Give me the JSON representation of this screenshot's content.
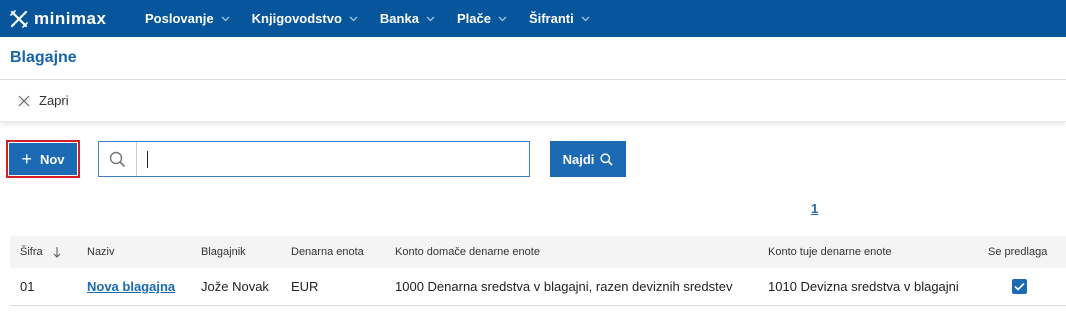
{
  "brand": {
    "name": "minimax"
  },
  "nav": {
    "items": [
      {
        "label": "Poslovanje"
      },
      {
        "label": "Knjigovodstvo"
      },
      {
        "label": "Banka"
      },
      {
        "label": "Plače"
      },
      {
        "label": "Šifranti"
      }
    ]
  },
  "page": {
    "title": "Blagajne"
  },
  "toolbar": {
    "close_label": "Zapri"
  },
  "actions": {
    "new_label": "Nov",
    "find_label": "Najdi"
  },
  "search": {
    "value": "",
    "placeholder": ""
  },
  "pagination": {
    "current": "1"
  },
  "table": {
    "headers": {
      "sifra": "Šifra",
      "naziv": "Naziv",
      "blagajnik": "Blagajnik",
      "denarna_enota": "Denarna enota",
      "konto_domace": "Konto domače denarne enote",
      "konto_tuje": "Konto tuje denarne enote",
      "se_predlaga": "Se predlaga"
    },
    "rows": [
      {
        "sifra": "01",
        "naziv": "Nova blagajna",
        "blagajnik": "Jože Novak",
        "denarna_enota": "EUR",
        "konto_domace": "1000 Denarna sredstva v blagajni, razen deviznih sredstev",
        "konto_tuje": "1010 Devizna sredstva v blagajni",
        "se_predlaga": true
      }
    ]
  },
  "colors": {
    "nav_bg": "#07559b",
    "accent": "#1b6ab3",
    "title": "#1565ad",
    "highlight": "#d32027"
  }
}
